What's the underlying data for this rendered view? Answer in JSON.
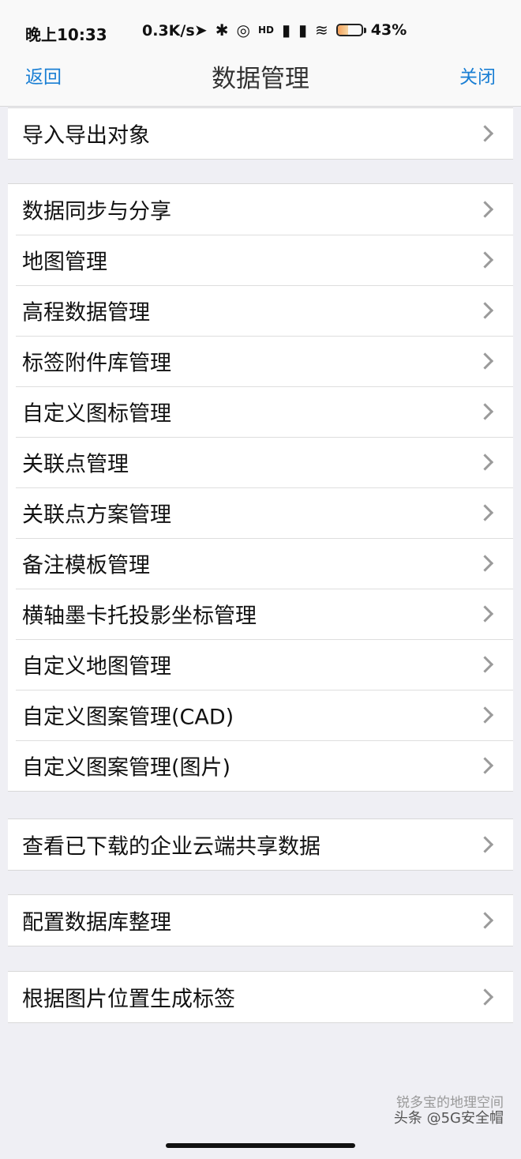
{
  "status_bar": {
    "time": "晚上10:33",
    "speed": "0.3K/s",
    "signal_label": "HD",
    "battery_percent": 43,
    "battery_label": "43%"
  },
  "nav": {
    "back_label": "返回",
    "title": "数据管理",
    "close_label": "关闭"
  },
  "groups": [
    {
      "items": [
        "导入导出对象"
      ]
    },
    {
      "items": [
        "数据同步与分享",
        "地图管理",
        "高程数据管理",
        "标签附件库管理",
        "自定义图标管理",
        "关联点管理",
        "关联点方案管理",
        "备注模板管理",
        "横轴墨卡托投影坐标管理",
        "自定义地图管理",
        "自定义图案管理(CAD)",
        "自定义图案管理(图片)"
      ]
    },
    {
      "items": [
        "查看已下载的企业云端共享数据"
      ]
    },
    {
      "items": [
        "配置数据库整理"
      ]
    },
    {
      "items": [
        "根据图片位置生成标签"
      ]
    }
  ],
  "watermark": {
    "line1": "头条 @5G安全帽",
    "line2": "锐多宝的地理空间"
  },
  "icons": {
    "row_chevron": "chevron-right-icon",
    "location": "location-arrow-icon",
    "bluetooth": "bluetooth-icon",
    "wifi": "wifi-icon"
  }
}
